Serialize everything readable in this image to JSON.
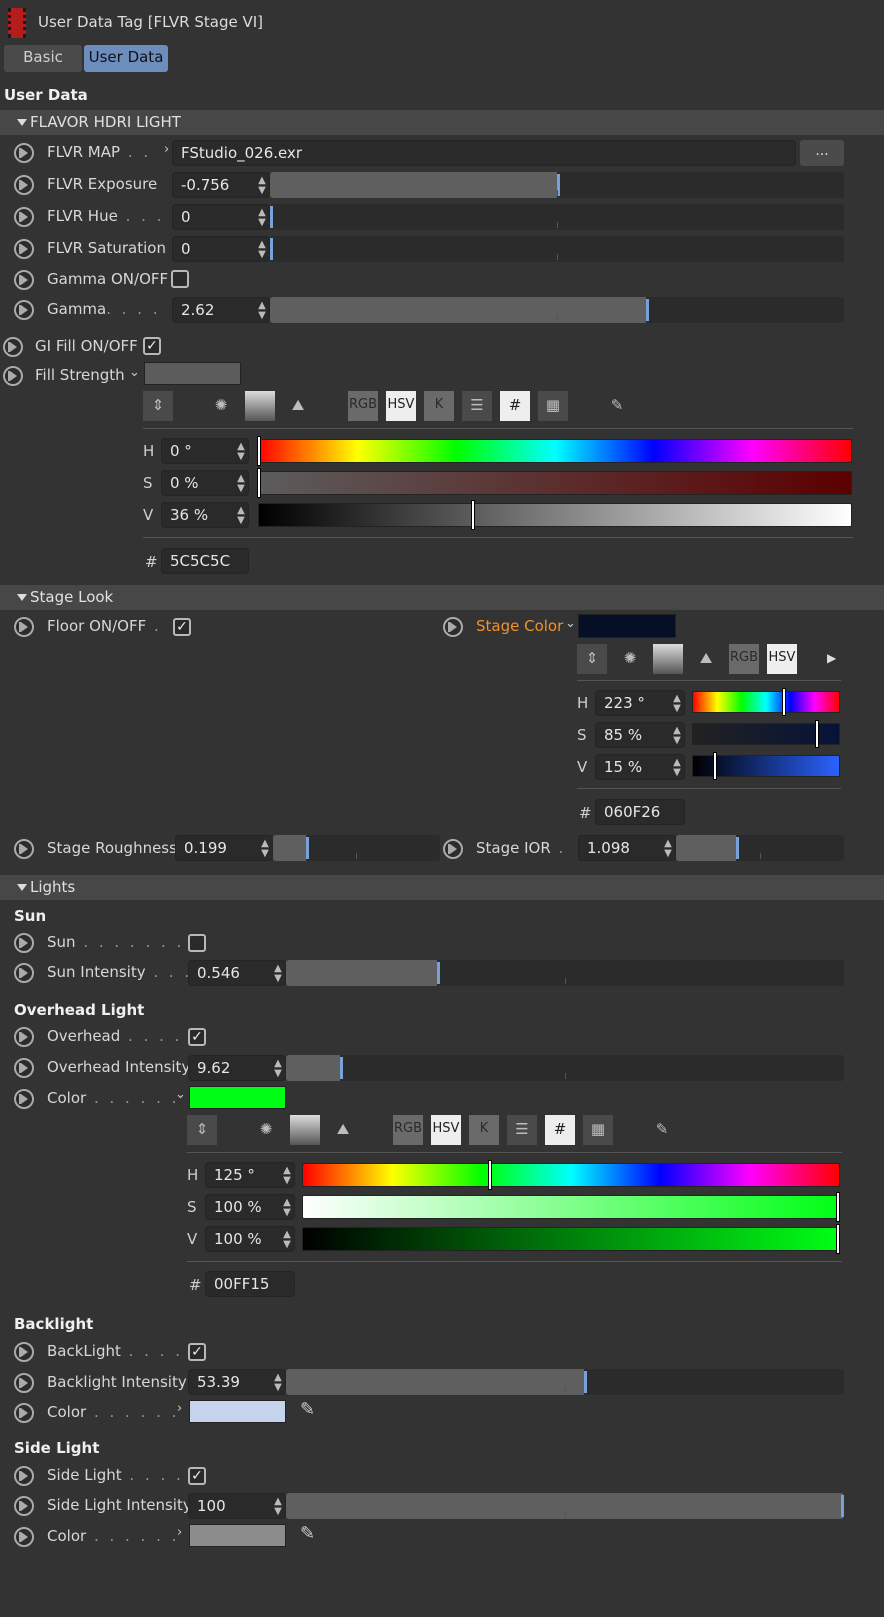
{
  "window": {
    "title": "User Data Tag [FLVR Stage VI]"
  },
  "tabs": {
    "basic": "Basic",
    "user_data": "User Data"
  },
  "section_title": "User Data",
  "groups": {
    "hdri": "FLAVOR HDRI LIGHT",
    "stage": "Stage Look",
    "lights": "Lights"
  },
  "hdri": {
    "map_label": "FLVR MAP",
    "map_value": "FStudio_026.exr",
    "browse_label": "...",
    "exposure_label": "FLVR Exposure",
    "exposure_value": "-0.756",
    "exposure_fraction": 0.5,
    "hue_label": "FLVR Hue",
    "hue_value": "0",
    "hue_fraction": 0.0,
    "sat_label": "FLVR Saturation",
    "sat_value": "0",
    "sat_fraction": 0.0,
    "gamma_onoff_label": "Gamma ON/OFF",
    "gamma_onoff_checked": false,
    "gamma_label": "Gamma",
    "gamma_value": "2.62",
    "gamma_fraction": 0.655,
    "gi_fill_label": "GI Fill ON/OFF",
    "gi_fill_checked": true,
    "fill_strength_label": "Fill Strength",
    "fill_color": "#5C5C5C",
    "icons": {
      "rgb": "RGB",
      "hsv": "HSV",
      "k": "K",
      "hash": "#"
    },
    "h_label": "H",
    "h_value": "0 °",
    "s_label": "S",
    "s_value": "0 %",
    "v_label": "V",
    "v_value": "36 %",
    "hash_label": "#",
    "hex_value": "5C5C5C"
  },
  "stage": {
    "floor_label": "Floor ON/OFF",
    "floor_checked": true,
    "stage_color_label": "Stage Color",
    "stage_color": "#060F26",
    "rgb": "RGB",
    "hsv": "HSV",
    "h_label": "H",
    "h_value": "223 °",
    "s_label": "S",
    "s_value": "85 %",
    "v_label": "V",
    "v_value": "15 %",
    "hash_label": "#",
    "hex_value": "060F26",
    "roughness_label": "Stage Roughness",
    "roughness_value": "0.199",
    "roughness_fraction": 0.2,
    "ior_label": "Stage IOR",
    "ior_value": "1.098",
    "ior_fraction": 0.36
  },
  "lights": {
    "sun_head": "Sun",
    "sun_label": "Sun",
    "sun_checked": false,
    "sun_intensity_label": "Sun Intensity",
    "sun_intensity_value": "0.546",
    "sun_fraction": 0.27,
    "overhead_head": "Overhead Light",
    "overhead_label": "Overhead",
    "overhead_checked": true,
    "overhead_intensity_label": "Overhead Intensity",
    "overhead_intensity_value": "9.62",
    "overhead_fraction": 0.097,
    "color_label": "Color",
    "overhead_color": "#00FF15",
    "rgb": "RGB",
    "hsv": "HSV",
    "k": "K",
    "hash": "#",
    "h_label": "H",
    "h_value": "125 °",
    "s_label": "S",
    "s_value": "100 %",
    "v_label": "V",
    "v_value": "100 %",
    "hash_label": "#",
    "hex_value": "00FF15",
    "back_head": "Backlight",
    "back_label": "BackLight",
    "back_checked": true,
    "back_intensity_label": "Backlight Intensity",
    "back_intensity_value": "53.39",
    "back_fraction": 0.534,
    "back_color": "#C5D3EC",
    "side_head": "Side Light",
    "side_label": "Side Light",
    "side_checked": true,
    "side_intensity_label": "Side Light Intensity",
    "side_intensity_value": "100",
    "side_fraction": 1.0,
    "side_color": "#8C8C8C"
  },
  "colors": {
    "accent": "#7AA0D9",
    "orange": "#F0922A"
  }
}
